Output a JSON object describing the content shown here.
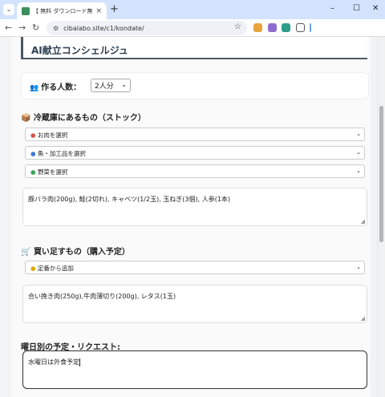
{
  "browser": {
    "tab_title": "【 無料 ダウンロード無し】献立 の...",
    "tab_close": "×",
    "new_tab": "+",
    "url": "cibalabo.site/c1/kondate/",
    "win_min": "–",
    "win_max": "☐",
    "win_close": "✕"
  },
  "page": {
    "title": "AI献立コンシェルジュ",
    "people": {
      "label": "作る人数：",
      "selected": "2人分"
    },
    "stock": {
      "title": "冷蔵庫にあるもの（ストック）",
      "dropdowns": [
        {
          "label": "お肉を選択",
          "icon": "meat-icon",
          "color": "#d9534f"
        },
        {
          "label": "魚・加工品を選択",
          "icon": "fish-icon",
          "color": "#3a7bd5"
        },
        {
          "label": "野菜を選択",
          "icon": "vegetable-icon",
          "color": "#3aa35a"
        }
      ],
      "textarea": "豚バラ肉(200g), 鮭(2切れ), キャベツ(1/2玉), 玉ねぎ(3個), 人参(1本)"
    },
    "shopping": {
      "title": "買い足すもの（購入予定）",
      "dropdown": "定番から追加",
      "textarea": "合い挽き肉(250g),牛肉薄切り(200g), レタス(1玉)"
    },
    "schedule": {
      "title": "曜日別の予定・リクエスト:",
      "textarea": "水曜日は外食予定"
    }
  }
}
